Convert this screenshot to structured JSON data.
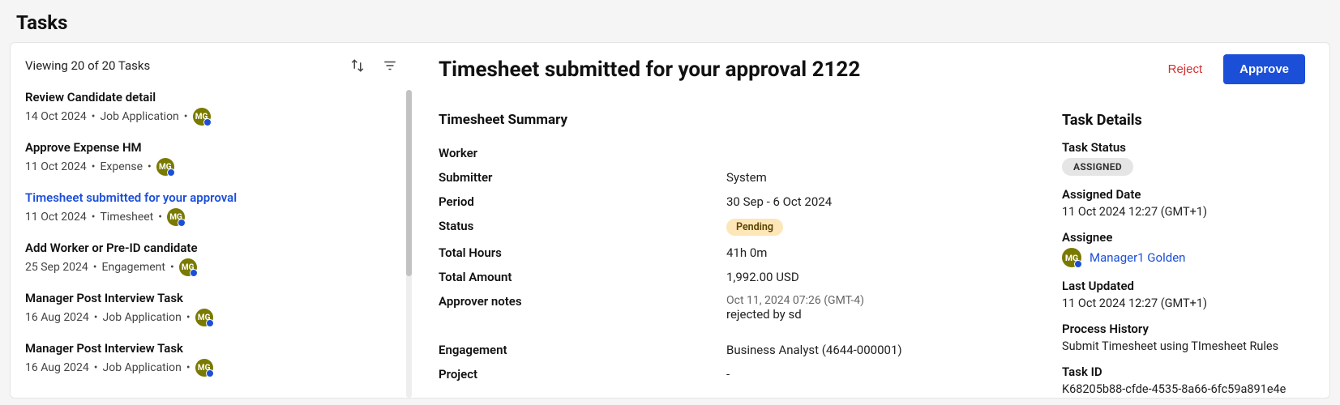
{
  "pageTitle": "Tasks",
  "viewing": "Viewing 20 of 20 Tasks",
  "avatarInitials": "MG",
  "taskList": [
    {
      "title": "Review Candidate detail",
      "date": "14 Oct 2024",
      "category": "Job Application",
      "selected": false
    },
    {
      "title": "Approve Expense HM",
      "date": "11 Oct 2024",
      "category": "Expense",
      "selected": false
    },
    {
      "title": "Timesheet submitted for your approval",
      "date": "11 Oct 2024",
      "category": "Timesheet",
      "selected": true
    },
    {
      "title": "Add Worker or Pre-ID candidate",
      "date": "25 Sep 2024",
      "category": "Engagement",
      "selected": false
    },
    {
      "title": "Manager Post Interview Task",
      "date": "16 Aug 2024",
      "category": "Job Application",
      "selected": false
    },
    {
      "title": "Manager Post Interview Task",
      "date": "16 Aug 2024",
      "category": "Job Application",
      "selected": false
    }
  ],
  "main": {
    "title": "Timesheet submitted for your approval 2122",
    "rejectLabel": "Reject",
    "approveLabel": "Approve"
  },
  "summary": {
    "heading": "Timesheet Summary",
    "worker_label": "Worker",
    "worker_value": "",
    "submitter_label": "Submitter",
    "submitter_value": "System",
    "period_label": "Period",
    "period_value": "30 Sep - 6 Oct 2024",
    "status_label": "Status",
    "status_value": "Pending",
    "totalHours_label": "Total Hours",
    "totalHours_value": "41h 0m",
    "totalAmount_label": "Total Amount",
    "totalAmount_value": "1,992.00 USD",
    "approverNotes_label": "Approver notes",
    "approverNotes_date": "Oct 11, 2024 07:26 (GMT-4)",
    "approverNotes_text": "rejected by sd",
    "engagement_label": "Engagement",
    "engagement_value": "Business Analyst (4644-000001)",
    "project_label": "Project",
    "project_value": "-"
  },
  "details": {
    "heading": "Task Details",
    "status_label": "Task Status",
    "status_value": "ASSIGNED",
    "assignedDate_label": "Assigned Date",
    "assignedDate_value": "11 Oct 2024 12:27 (GMT+1)",
    "assignee_label": "Assignee",
    "assignee_value": "Manager1 Golden",
    "lastUpdated_label": "Last Updated",
    "lastUpdated_value": "11 Oct 2024 12:27 (GMT+1)",
    "processHistory_label": "Process History",
    "processHistory_value": "Submit Timesheet using TImesheet Rules",
    "taskId_label": "Task ID",
    "taskId_value": "K68205b88-cfde-4535-8a66-6fc59a891e4e"
  }
}
